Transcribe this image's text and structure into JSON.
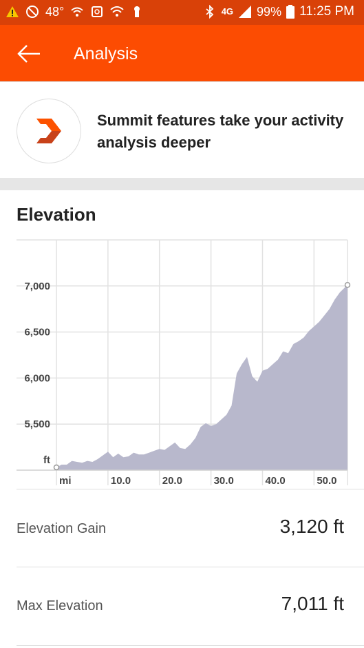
{
  "status_bar": {
    "icons_left": [
      "warning-icon",
      "block-icon",
      "wifi-calling-icon",
      "sync-icon",
      "wifi-icon",
      "keyhole-icon"
    ],
    "temperature": "48°",
    "network": "4G",
    "battery": "99%",
    "time": "11:25 PM"
  },
  "appbar": {
    "title": "Analysis",
    "back_icon": "arrow-left-icon"
  },
  "banner": {
    "text": "Summit features take your activity analysis deeper",
    "icon": "summit-chevron-icon"
  },
  "elevation": {
    "title": "Elevation"
  },
  "chart_data": {
    "type": "area",
    "xlabel": "mi",
    "ylabel": "ft",
    "x_ticks": [
      "10.0",
      "20.0",
      "30.0",
      "40.0",
      "50.0"
    ],
    "y_ticks": [
      "5,500",
      "6,000",
      "6,500",
      "7,000"
    ],
    "xlim": [
      0,
      56.5
    ],
    "ylim": [
      5000,
      7500
    ],
    "grid": true,
    "color": "#b8b8cc",
    "x": [
      0,
      1,
      2,
      3,
      4,
      5,
      6,
      7,
      8,
      9,
      10,
      11,
      12,
      13,
      14,
      15,
      16,
      17,
      18,
      19,
      20,
      21,
      22,
      23,
      24,
      25,
      26,
      27,
      28,
      29,
      30,
      31,
      32,
      33,
      34,
      35,
      36,
      37,
      38,
      39,
      40,
      41,
      42,
      43,
      44,
      45,
      46,
      47,
      48,
      49,
      50,
      51,
      52,
      53,
      54,
      55,
      56.5
    ],
    "y": [
      5030,
      5060,
      5060,
      5100,
      5090,
      5080,
      5100,
      5090,
      5120,
      5160,
      5200,
      5140,
      5180,
      5140,
      5150,
      5190,
      5170,
      5170,
      5190,
      5210,
      5230,
      5220,
      5260,
      5300,
      5240,
      5230,
      5280,
      5350,
      5470,
      5510,
      5480,
      5500,
      5550,
      5600,
      5700,
      6050,
      6150,
      6230,
      6020,
      5960,
      6080,
      6100,
      6150,
      6200,
      6290,
      6270,
      6370,
      6400,
      6440,
      6510,
      6560,
      6610,
      6680,
      6750,
      6850,
      6930,
      7011
    ]
  },
  "stats": [
    {
      "label": "Elevation Gain",
      "value": "3,120 ft"
    },
    {
      "label": "Max Elevation",
      "value": "7,011 ft"
    }
  ]
}
